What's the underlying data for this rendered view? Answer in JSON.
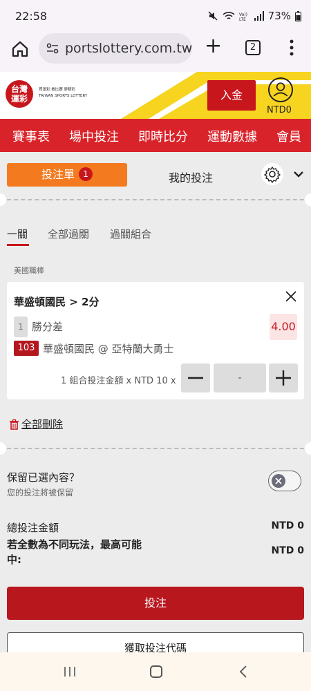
{
  "status_bar": {
    "time": "22:58",
    "battery": "73%"
  },
  "browser": {
    "url": "portslottery.com.tw",
    "tab_count": "2"
  },
  "site": {
    "logo": "台灣\n運彩",
    "logo_tagline": "買運彩 看比賽 更精彩",
    "logo_english": "TAIWAN SPORTS LOTTERY",
    "deposit_label": "入金",
    "currency_label": "NTD0",
    "brand_red": "#d9232a",
    "accent_orange": "#f47a1f"
  },
  "nav": {
    "items": [
      "賽事表",
      "場中投注",
      "即時比分",
      "運動數據",
      "會員"
    ]
  },
  "slip": {
    "tab_betslip": "投注單",
    "badge_count": "1",
    "tab_my_bets": "我的投注",
    "type_tabs": [
      "一關",
      "全部過關",
      "過關組合"
    ],
    "league": "美國職棒",
    "bet": {
      "title": "華盛頓國民 > 2分",
      "selection_no": "1",
      "market": "勝分差",
      "odds": "4.00",
      "event_code": "103",
      "match": "華盛頓國民 @ 亞特蘭大勇士",
      "stake_label": "1 組合投注金額 x NTD 10 x",
      "stake_value": "-"
    },
    "delete_all": "全部刪除",
    "keep_title": "保留已選內容？",
    "keep_subtitle": "您的投注將被保留",
    "keep_enabled": false,
    "total_label": "總投注金額",
    "total_value": "NTD 0",
    "max_label": "若全數為不同玩法，最高可能中:",
    "max_value": "NTD 0",
    "place_button": "投注",
    "code_button": "獲取投注代碼"
  }
}
